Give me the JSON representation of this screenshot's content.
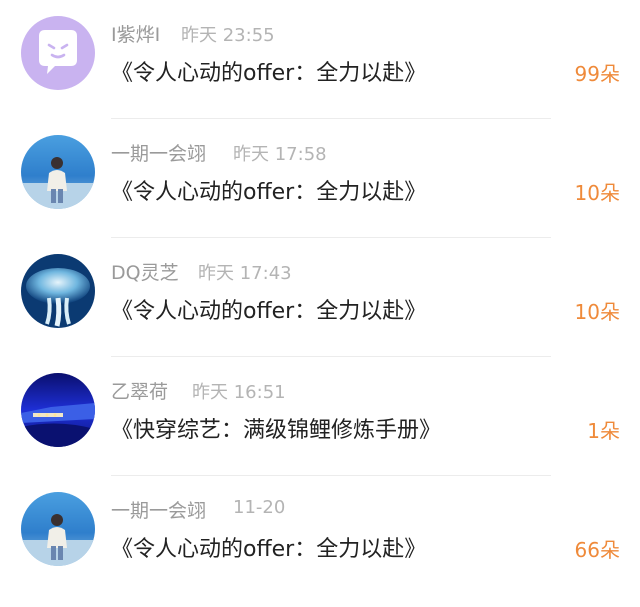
{
  "items": [
    {
      "user": "Ⅰ紫烨Ⅰ",
      "time": "昨天 23:55",
      "book": "《令人心动的offer：全力以赴》",
      "count": "99朵",
      "avatar_icon": "chat-bubble-emoji-icon"
    },
    {
      "user": "一期一会翊",
      "time": "昨天 17:58",
      "book": "《令人心动的offer：全力以赴》",
      "count": "10朵",
      "avatar_icon": "person-by-sea-photo"
    },
    {
      "user": "DQ灵芝",
      "time": "昨天 17:43",
      "book": "《令人心动的offer：全力以赴》",
      "count": "10朵",
      "avatar_icon": "blue-jellyfish-photo"
    },
    {
      "user": "乙翠荷",
      "time": "昨天 16:51",
      "book": "《快穿综艺：满级锦鲤修炼手册》",
      "count": "1朵",
      "avatar_icon": "night-blue-landscape-photo"
    },
    {
      "user": "一期一会翊",
      "time": "11-20",
      "book": "《令人心动的offer：全力以赴》",
      "count": "66朵",
      "avatar_icon": "person-by-sea-photo"
    }
  ],
  "colors": {
    "count": "#ef8a3a",
    "name": "#9a9a9a",
    "time": "#b4b4b4",
    "title": "#222222",
    "avatar_purple": "#c9b3f0"
  }
}
